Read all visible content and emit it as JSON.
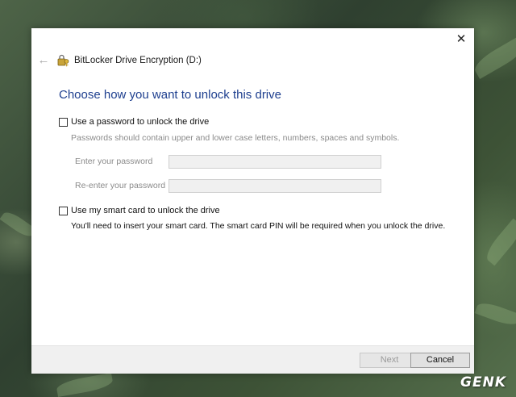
{
  "window": {
    "title": "BitLocker Drive Encryption (D:)",
    "close_glyph": "✕",
    "back_glyph": "←",
    "back_icon": "back-arrow-icon",
    "app_icon": "bitlocker-key-icon"
  },
  "main": {
    "heading": "Choose how you want to unlock this drive",
    "password_option": {
      "label": "Use a password to unlock the drive",
      "checked": false,
      "hint": "Passwords should contain upper and lower case letters, numbers, spaces and symbols.",
      "enter_label": "Enter your password",
      "reenter_label": "Re-enter your password",
      "enter_value": "",
      "reenter_value": ""
    },
    "smartcard_option": {
      "label": "Use my smart card to unlock the drive",
      "checked": false,
      "hint": "You'll need to insert your smart card. The smart card PIN will be required when you unlock the drive."
    }
  },
  "footer": {
    "next_label": "Next",
    "next_enabled": false,
    "cancel_label": "Cancel"
  },
  "watermark": "GENK",
  "colors": {
    "heading": "#1e3f8f",
    "disabled_text": "#8a8a8a",
    "footer_bg": "#f0f0f0"
  }
}
